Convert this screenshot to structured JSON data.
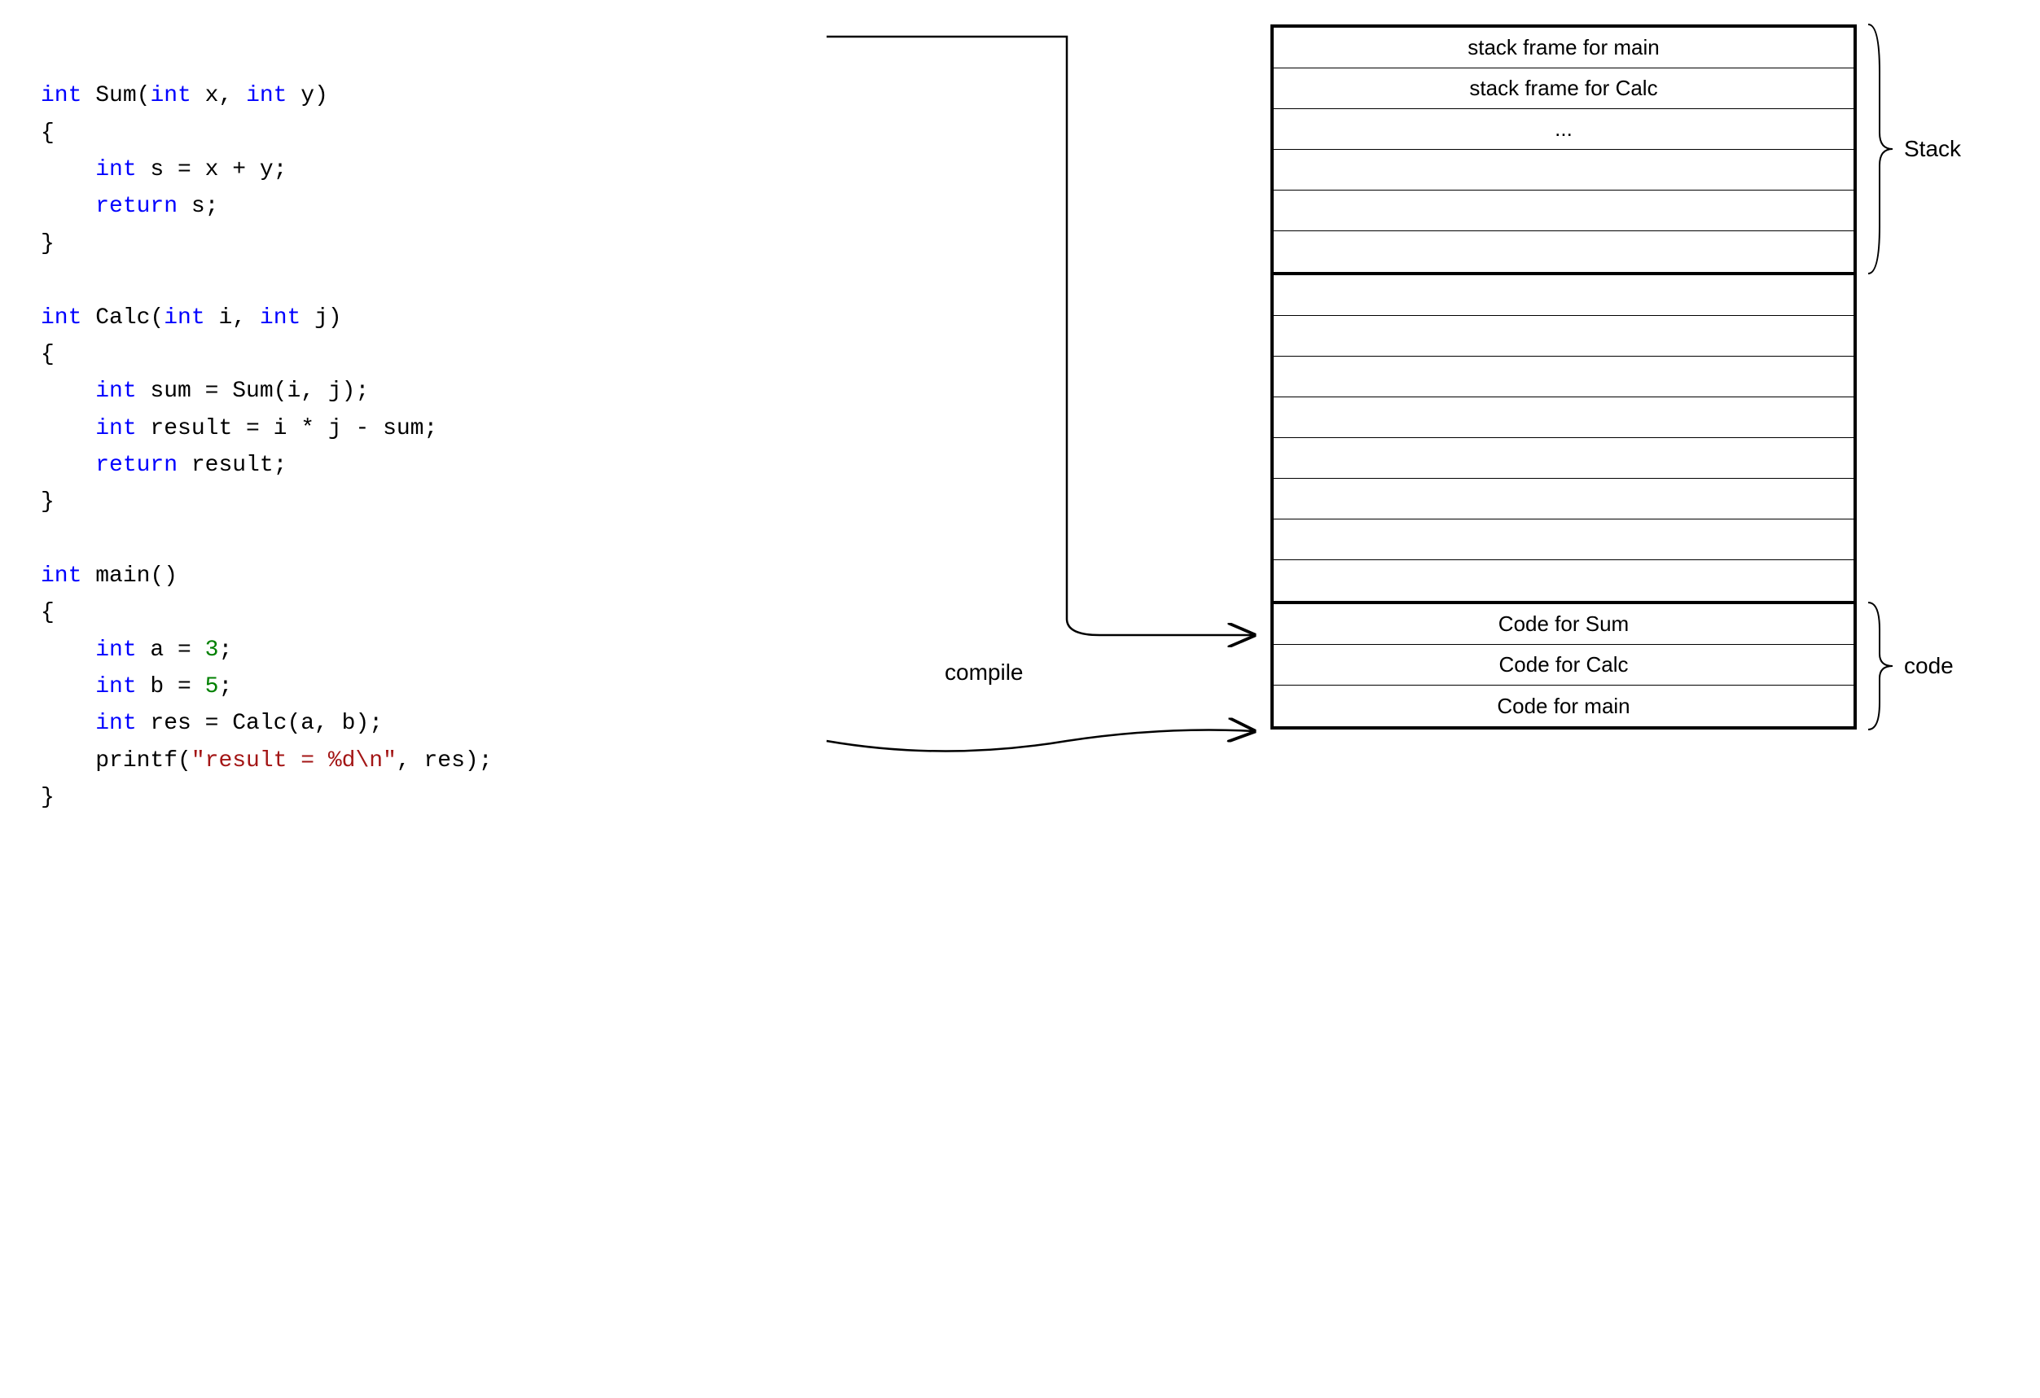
{
  "code": {
    "sum": {
      "sig_prefix": "int",
      "name": " Sum(",
      "p1t": "int",
      "p1n": " x, ",
      "p2t": "int",
      "p2n": " y)",
      "open": "{",
      "l1_kw": "    int",
      "l1_rest": " s = x + y;",
      "l2_kw": "    return",
      "l2_rest": " s;",
      "close": "}"
    },
    "calc": {
      "sig_prefix": "int",
      "name": " Calc(",
      "p1t": "int",
      "p1n": " i, ",
      "p2t": "int",
      "p2n": " j)",
      "open": "{",
      "l1_kw": "    int",
      "l1_rest": " sum = Sum(i, j);",
      "l2_kw": "    int",
      "l2_rest": " result = i * j - sum;",
      "l3_kw": "    return",
      "l3_rest": " result;",
      "close": "}"
    },
    "main": {
      "sig_prefix": "int",
      "name": " main()",
      "open": "{",
      "l1_kw": "    int",
      "l1_mid": " a = ",
      "l1_num": "3",
      "l1_end": ";",
      "l2_kw": "    int",
      "l2_mid": " b = ",
      "l2_num": "5",
      "l2_end": ";",
      "l3_kw": "    int",
      "l3_rest": " res = Calc(a, b);",
      "l4_pre": "    printf(",
      "l4_str": "\"result = %d\\n\"",
      "l4_post": ", res);",
      "close": "}"
    }
  },
  "memory": {
    "stack": {
      "rows": [
        "stack frame for main",
        "stack frame for Calc",
        "...",
        "",
        "",
        ""
      ],
      "label": "Stack"
    },
    "middle_rows": 8,
    "code_seg": {
      "rows": [
        "Code for Sum",
        "Code for Calc",
        "Code for main"
      ],
      "label": "code"
    }
  },
  "arrow_label": "compile"
}
